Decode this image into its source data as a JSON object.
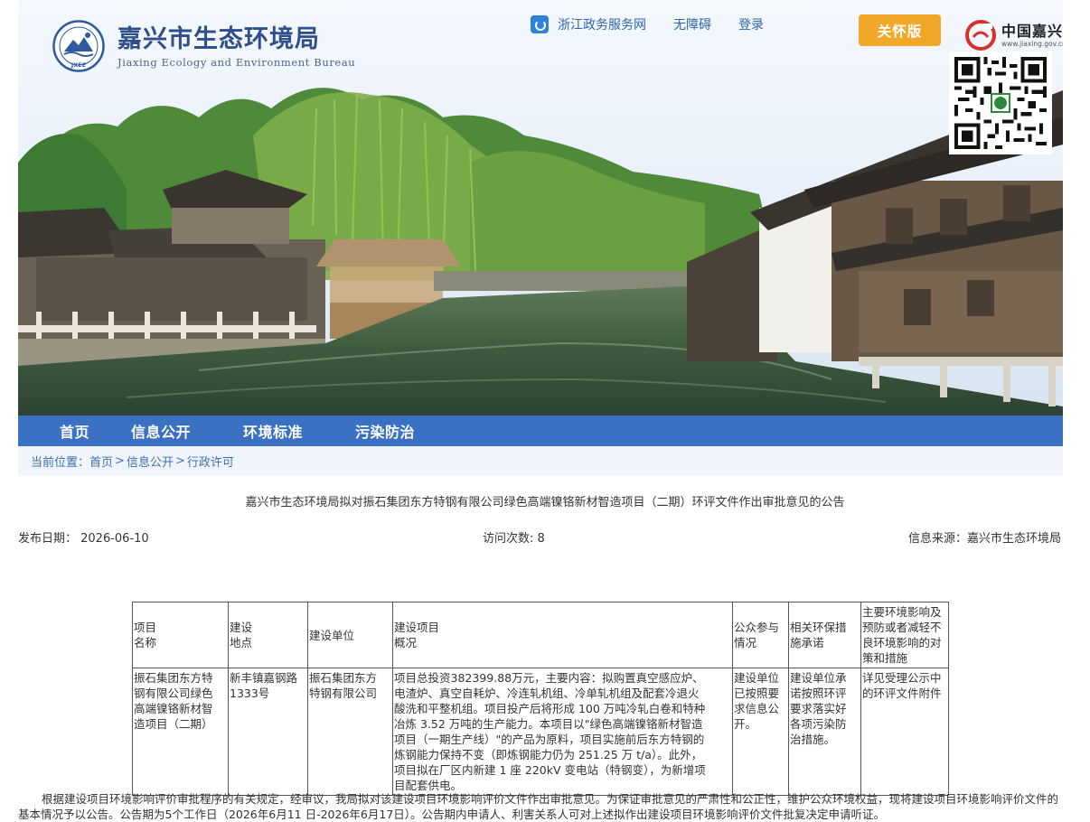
{
  "header": {
    "org_name": "嘉兴市生态环境局",
    "org_name_en": "Jiaxing Ecology and Environment Bureau",
    "emblem_text": "JXEE",
    "links": {
      "service": "浙江政务服务网",
      "accessibility": "无障碍",
      "login": "登录"
    },
    "care_button": "关怀版",
    "portal_name": "中国嘉兴",
    "portal_url": "www.jiaxing.gov.cn"
  },
  "nav": {
    "items": [
      "首页",
      "信息公开",
      "环境标准",
      "污染防治"
    ]
  },
  "breadcrumb": {
    "prefix": "当前位置：",
    "items": [
      "首页",
      "信息公开",
      "行政许可"
    ],
    "separator": ">"
  },
  "article": {
    "title": "嘉兴市生态环境局拟对振石集团东方特钢有限公司绿色高端镍铬新材智造项目（二期）环评文件作出审批意见的公告",
    "publish_date": "发布日期：  2026-06-10",
    "visits": "访问次数: 8",
    "source": "信息来源：嘉兴市生态环境局",
    "table": {
      "headers": [
        "项目\n名称",
        "建设\n地点",
        "建设单位",
        "建设项目\n概况",
        "公众参与\n情况",
        "相关环保措\n施承诺",
        "主要环境影响及\n预防或者减轻不\n良环境影响的对\n策和措施"
      ],
      "row": [
        "振石集团东方特\n钢有限公司绿色\n高端镍铬新材智\n造项目（二期）",
        "新丰镇嘉钢路\n1333号",
        "振石集团东方\n特钢有限公司",
        "项目总投资382399.88万元，主要内容：拟购置真空感应炉、\n电渣炉、真空自耗炉、冷连轧机组、冷单轧机组及配套冷退火\n酸洗和平整机组。项目投产后将形成 100 万吨冷轧白卷和特种\n冶炼 3.52 万吨的生产能力。本项目以\"绿色高端镍铬新材智造\n项目（一期生产线）\"的产品为原料，项目实施前后东方特钢的\n炼钢能力保持不变（即炼钢能力仍为 251.25 万 t/a）。此外，\n项目拟在厂区内新建 1 座 220kV 变电站（特钢变），为新增项\n目配套供电。",
        "建设单位\n已按照要\n求信息公\n开。",
        "建设单位承\n诺按照环评\n要求落实好\n各项污染防\n治措施。",
        "详见受理公示中\n的环评文件附件"
      ]
    },
    "body": "根据建设项目环境影响评价审批程序的有关规定，经审议，我局拟对该建设项目环境影响评价文件作出审批意见。为保证审批意见的严肃性和公正性，维护公众环境权益，现将建设项目环境影响评价文件的基本情况予以公告。公告期为5个工作日（2026年6月11 日-2026年6月17日）。公告期内申请人、利害关系人可对上述拟作出建设项目环境影响评价文件批复决定申请听证。"
  },
  "colors": {
    "nav": "#3b71c2",
    "care_button": "#f1a728",
    "link": "#2b66b1",
    "breadcrumb_bg": "#f1f5fb"
  }
}
